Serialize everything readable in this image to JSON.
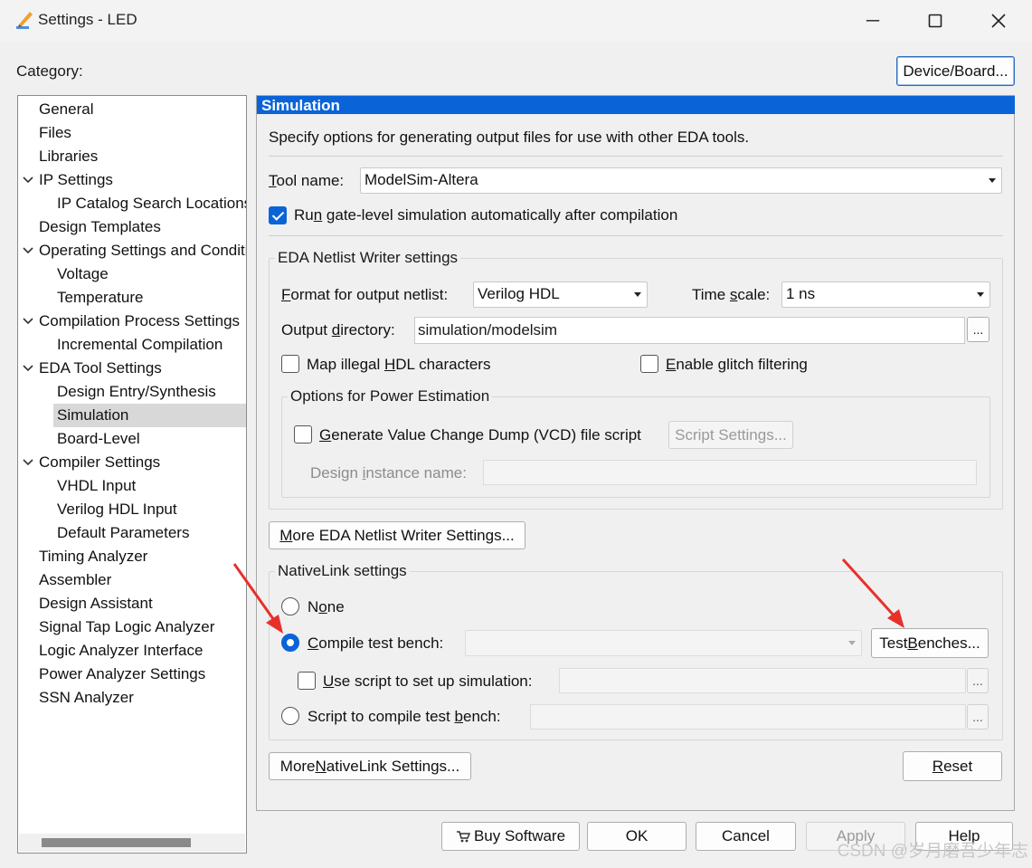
{
  "window": {
    "title": "Settings - LED",
    "minimize_glyph": "─",
    "maximize_glyph": "☐",
    "close_glyph": "✕"
  },
  "category_label": "Category:",
  "device_board_button": "Device/Board...",
  "tree": [
    {
      "label": "General",
      "level": 0,
      "expanded": null,
      "selected": false
    },
    {
      "label": "Files",
      "level": 0,
      "expanded": null,
      "selected": false
    },
    {
      "label": "Libraries",
      "level": 0,
      "expanded": null,
      "selected": false
    },
    {
      "label": "IP Settings",
      "level": 0,
      "expanded": true,
      "selected": false
    },
    {
      "label": "IP Catalog Search Locations",
      "level": 1,
      "expanded": null,
      "selected": false
    },
    {
      "label": "Design Templates",
      "level": 0,
      "expanded": null,
      "selected": false
    },
    {
      "label": "Operating Settings and Conditions",
      "level": 0,
      "expanded": true,
      "selected": false
    },
    {
      "label": "Voltage",
      "level": 1,
      "expanded": null,
      "selected": false
    },
    {
      "label": "Temperature",
      "level": 1,
      "expanded": null,
      "selected": false
    },
    {
      "label": "Compilation Process Settings",
      "level": 0,
      "expanded": true,
      "selected": false
    },
    {
      "label": "Incremental Compilation",
      "level": 1,
      "expanded": null,
      "selected": false
    },
    {
      "label": "EDA Tool Settings",
      "level": 0,
      "expanded": true,
      "selected": false
    },
    {
      "label": "Design Entry/Synthesis",
      "level": 1,
      "expanded": null,
      "selected": false
    },
    {
      "label": "Simulation",
      "level": 1,
      "expanded": null,
      "selected": true
    },
    {
      "label": "Board-Level",
      "level": 1,
      "expanded": null,
      "selected": false
    },
    {
      "label": "Compiler Settings",
      "level": 0,
      "expanded": true,
      "selected": false
    },
    {
      "label": "VHDL Input",
      "level": 1,
      "expanded": null,
      "selected": false
    },
    {
      "label": "Verilog HDL Input",
      "level": 1,
      "expanded": null,
      "selected": false
    },
    {
      "label": "Default Parameters",
      "level": 1,
      "expanded": null,
      "selected": false
    },
    {
      "label": "Timing Analyzer",
      "level": 0,
      "expanded": null,
      "selected": false
    },
    {
      "label": "Assembler",
      "level": 0,
      "expanded": null,
      "selected": false
    },
    {
      "label": "Design Assistant",
      "level": 0,
      "expanded": null,
      "selected": false
    },
    {
      "label": "Signal Tap Logic Analyzer",
      "level": 0,
      "expanded": null,
      "selected": false
    },
    {
      "label": "Logic Analyzer Interface",
      "level": 0,
      "expanded": null,
      "selected": false
    },
    {
      "label": "Power Analyzer Settings",
      "level": 0,
      "expanded": null,
      "selected": false
    },
    {
      "label": "SSN Analyzer",
      "level": 0,
      "expanded": null,
      "selected": false
    }
  ],
  "panel": {
    "header": "Simulation",
    "description": "Specify options for generating output files for use with other EDA tools.",
    "tool_name": {
      "label_u": "T",
      "label_rest": "ool name:",
      "value": "ModelSim-Altera"
    },
    "run_gate_level": {
      "label_pre": "Ru",
      "label_u": "n",
      "label_rest": " gate-level simulation automatically after compilation",
      "checked": true
    },
    "netlist": {
      "title": "EDA Netlist Writer settings",
      "format_label_u": "F",
      "format_label_rest": "ormat for output netlist:",
      "format_value": "Verilog HDL",
      "timescale_label_pre": "Time ",
      "timescale_label_u": "s",
      "timescale_label_rest": "cale:",
      "timescale_value": "1 ns",
      "outdir_label_pre": "Output ",
      "outdir_label_u": "d",
      "outdir_label_rest": "irectory:",
      "outdir_value": "simulation/modelsim",
      "browse": "...",
      "map_illegal": {
        "pre": "Map illegal ",
        "u": "H",
        "rest": "DL characters",
        "checked": false
      },
      "glitch": {
        "pre": "",
        "u": "E",
        "rest": "nable glitch filtering",
        "checked": false
      },
      "power": {
        "title": "Options for Power Estimation",
        "vcd": {
          "pre": "",
          "u": "G",
          "rest": "enerate Value Change Dump (VCD) file script",
          "checked": false
        },
        "script_settings": "Script Settings...",
        "instance_label_pre": "Design ",
        "instance_label_u": "i",
        "instance_label_rest": "nstance name:",
        "instance_value": ""
      }
    },
    "more_netlist": {
      "pre": "",
      "u": "M",
      "rest": "ore EDA Netlist Writer Settings..."
    },
    "nativelink": {
      "title": "NativeLink settings",
      "none": {
        "pre": "N",
        "u": "o",
        "rest": "ne",
        "selected": false
      },
      "compile_tb": {
        "pre": "",
        "u": "C",
        "rest": "ompile test bench:",
        "selected": true,
        "value": ""
      },
      "test_benches": {
        "pre": "Test ",
        "u": "B",
        "rest": "enches..."
      },
      "use_script": {
        "pre": "",
        "u": "U",
        "rest": "se script to set up simulation:",
        "checked": false,
        "value": ""
      },
      "script_compile": {
        "pre": "Script to compile test ",
        "u": "b",
        "rest": "ench:",
        "selected": false,
        "value": ""
      },
      "browse": "..."
    },
    "more_nativelink": {
      "pre": "More ",
      "u": "N",
      "rest": "ativeLink Settings..."
    },
    "reset": {
      "pre": "",
      "u": "R",
      "rest": "eset"
    }
  },
  "footer": {
    "buy": "Buy Software",
    "ok": "OK",
    "cancel": "Cancel",
    "apply": "Apply",
    "help": "Help"
  },
  "watermark": "CSDN @岁月磨吾少年志",
  "colors": {
    "accent": "#0a64d8",
    "annotation_arrow": "#e8302a"
  }
}
